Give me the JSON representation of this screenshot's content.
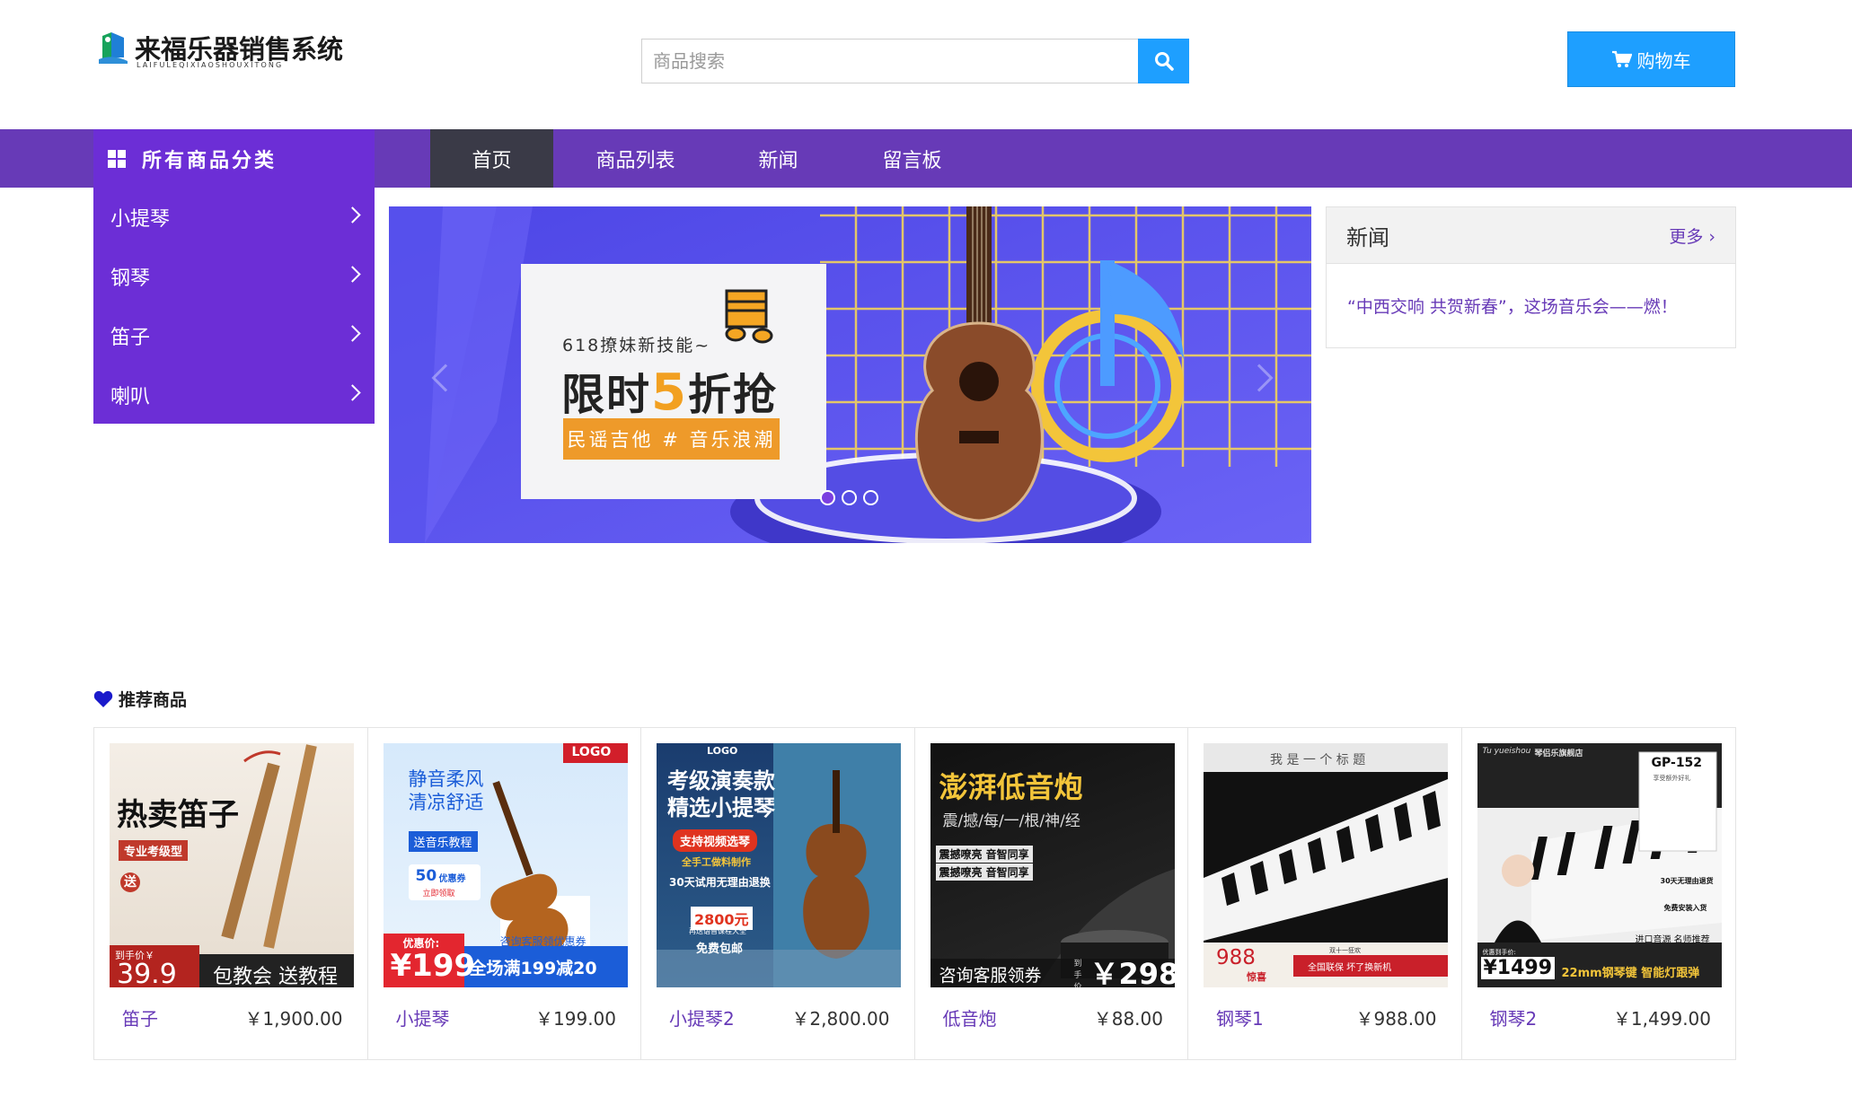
{
  "brand": {
    "title": "来福乐器销售系统",
    "subtitle": "LAIFULEQIXIAOSHOUXITONG"
  },
  "search": {
    "placeholder": "商品搜索",
    "button_icon": "search-icon"
  },
  "cart": {
    "label": "购物车",
    "icon": "cart-icon"
  },
  "nav": {
    "category_header": "所有商品分类",
    "items": [
      {
        "label": "首页",
        "active": true
      },
      {
        "label": "商品列表",
        "active": false
      },
      {
        "label": "新闻",
        "active": false
      },
      {
        "label": "留言板",
        "active": false
      }
    ]
  },
  "categories": [
    "小提琴",
    "钢琴",
    "笛子",
    "喇叭"
  ],
  "banner": {
    "line1": "618撩妹新技能~",
    "line2_pre": "限时",
    "line2_num": "5",
    "line2_post": "折抢",
    "tag": "民谣吉他 # 音乐浪潮",
    "slides": 3,
    "active_slide": 1
  },
  "news": {
    "title": "新闻",
    "more": "更多",
    "items": [
      "“中西交响 共贺新春”，这场音乐会——燃！"
    ]
  },
  "recommend": {
    "title": "推荐商品",
    "products": [
      {
        "name": "笛子",
        "price": "￥1,900.00",
        "img": {
          "a": "热卖笛子",
          "b": "专业考级型",
          "c": "送",
          "d": "到手价￥",
          "e": "39.9",
          "f": "包教会 送教程"
        }
      },
      {
        "name": "小提琴",
        "price": "￥199.00",
        "img": {
          "a": "静音柔风",
          "b": "清凉舒适",
          "c": "送音乐教程",
          "d": "LOGO",
          "e": "优惠价:",
          "f": "¥199",
          "g": "全场满199减20",
          "h": "咨询客服领优惠券",
          "i": "50",
          "j": "优惠券",
          "k": "立即领取"
        }
      },
      {
        "name": "小提琴2",
        "price": "￥2,800.00",
        "img": {
          "a": "LOGO",
          "b": "考级演奏款",
          "c": "精选小提琴",
          "d": "支持视频选琴",
          "e": "全手工做料制作",
          "f": "30天试用无理由退换",
          "g": "2800元",
          "h": "再送语音课程大全",
          "i": "免费包邮"
        }
      },
      {
        "name": "低音炮",
        "price": "￥88.00",
        "img": {
          "a": "澎湃低音炮",
          "b": "震/撼/每/一/根/神/经",
          "c": "震撼嘹亮 音智同享",
          "d": "咨询客服领券",
          "e": "到手价",
          "f": "￥298"
        }
      },
      {
        "name": "钢琴1",
        "price": "￥988.00",
        "img": {
          "a": "我 是 一 个 标 题",
          "b": "988",
          "c": "惊喜",
          "d": "全国联保 坏了换新机",
          "e": "双十一狂欢"
        }
      },
      {
        "name": "钢琴2",
        "price": "￥1,499.00",
        "img": {
          "a": "GP-152",
          "b": "进口音源 名师推荐",
          "c": "¥1499",
          "d": "22mm钢琴键 智能灯跟弹",
          "e": "30天无理由退货",
          "f": "免费安装入货",
          "g": "优惠到手价:",
          "h": "琴侣乐旗舰店",
          "i": "Tu yueishou",
          "j": "享受额外好礼"
        }
      }
    ]
  },
  "colors": {
    "nav_purple": "#673ab7",
    "menu_purple": "#6c2ed6",
    "accent_blue": "#1e9fff",
    "active_nav": "#3a3a47"
  }
}
